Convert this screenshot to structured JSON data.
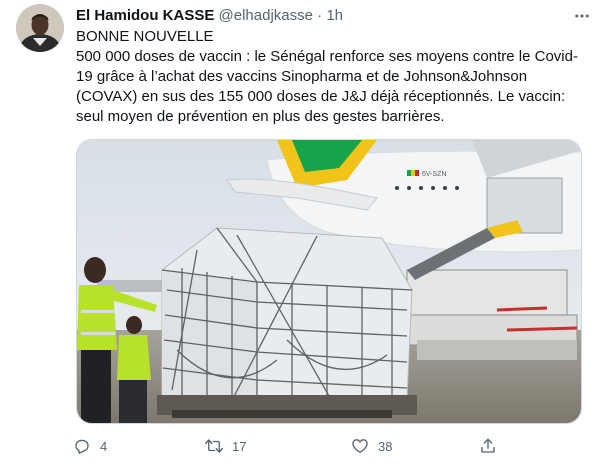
{
  "tweet": {
    "author_name": "El Hamidou KASSE",
    "author_handle": "@elhadjkasse",
    "separator": "·",
    "time": "1h",
    "text_line1": "BONNE NOUVELLE",
    "text_line2": "500 000 doses de vaccin : le Sénégal renforce ses moyens contre le Covid-19 grâce à l’achat des vaccins Sinopharma et de Johnson&Johnson (COVAX) en sus des 155 000 doses de J&J déjà réceptionnés. Le vaccin: seul moyen de prévention en plus des gestes barrières.",
    "media_icon": "photo",
    "plane_registration": "6V-SZN"
  },
  "actions": {
    "reply_count": "4",
    "retweet_count": "17",
    "like_count": "38",
    "reply_icon": "reply-icon",
    "retweet_icon": "retweet-icon",
    "like_icon": "heart-icon",
    "share_icon": "share-icon"
  },
  "colors": {
    "text": "#0f1419",
    "secondary": "#536471",
    "border": "#cfd9de",
    "sky": "#dfe6ec",
    "vest": "#b8e22a",
    "plane_green": "#18a24a",
    "plane_yellow": "#f2c318"
  }
}
